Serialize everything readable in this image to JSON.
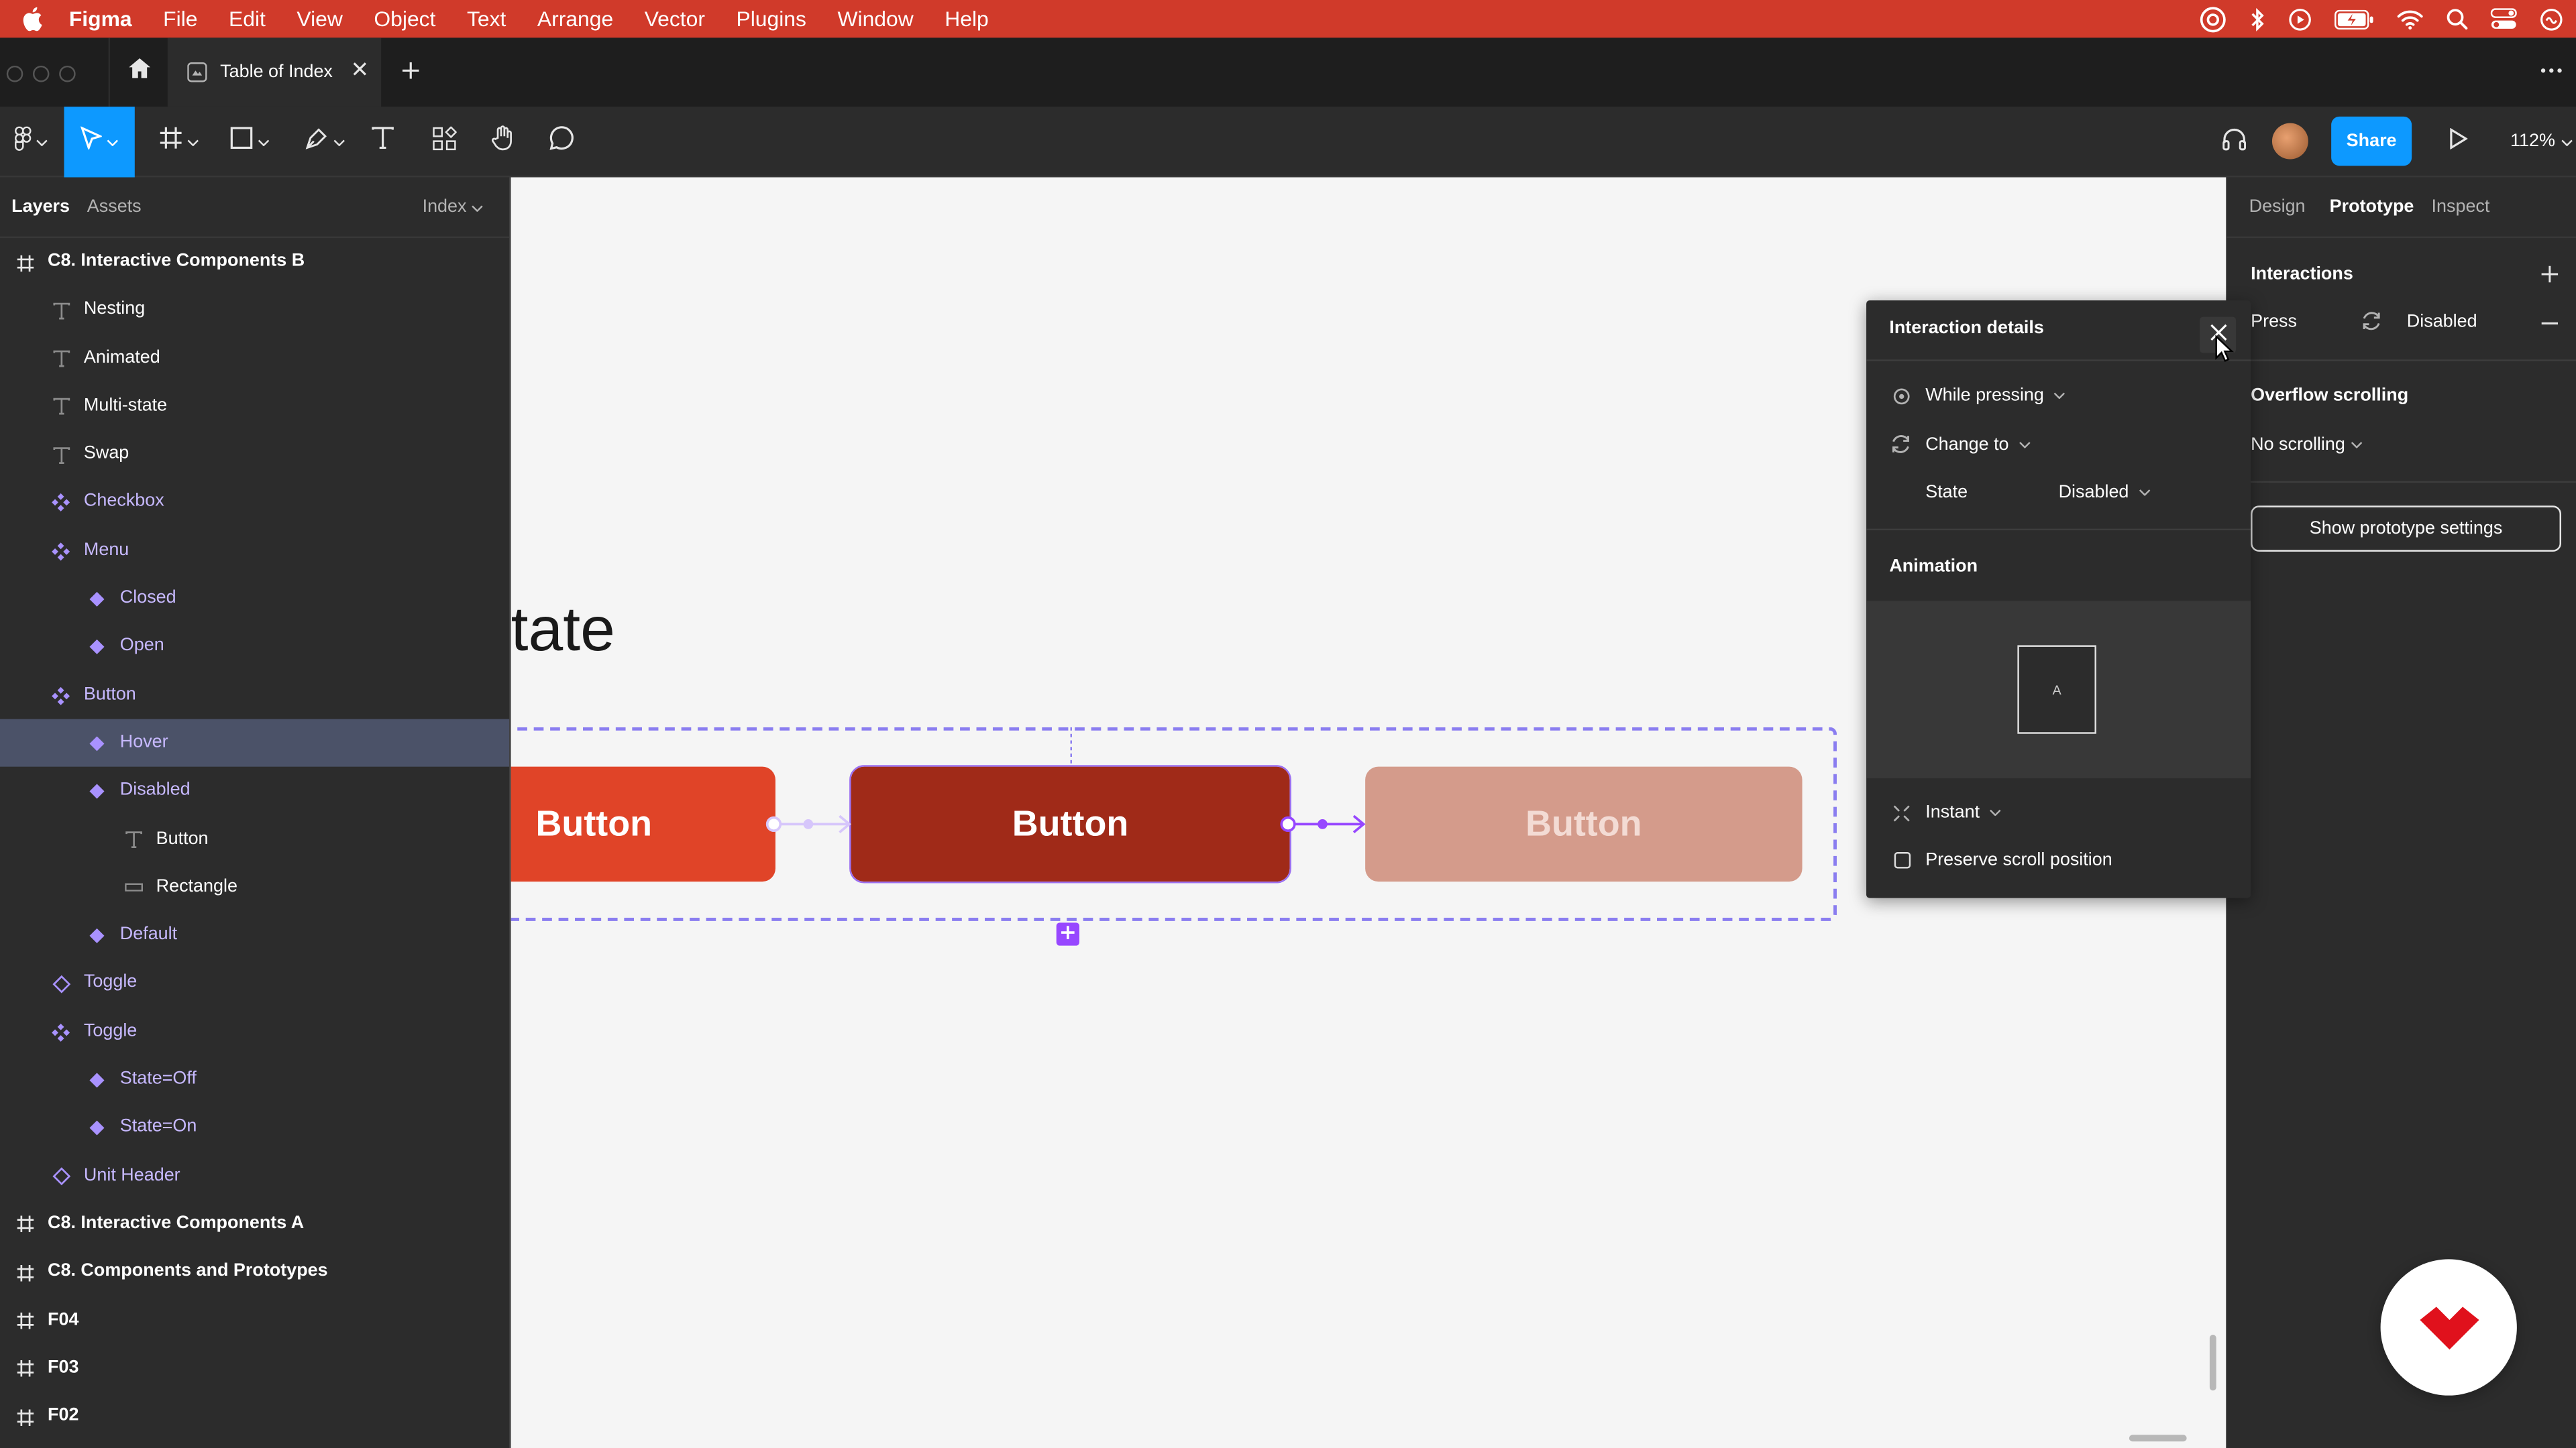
{
  "menubar": {
    "app_name": "Figma",
    "items": [
      "File",
      "Edit",
      "View",
      "Object",
      "Text",
      "Arrange",
      "Vector",
      "Plugins",
      "Window",
      "Help"
    ]
  },
  "tabbar": {
    "doc_title": "Table of Index"
  },
  "toolbar": {
    "share_label": "Share",
    "zoom": "112%"
  },
  "layers_panel": {
    "tab_layers": "Layers",
    "tab_assets": "Assets",
    "page_selector": "Index",
    "rows": [
      {
        "label": "C8. Interactive Components B",
        "kind": "frame",
        "indent": 0
      },
      {
        "label": "Nesting",
        "kind": "text",
        "indent": 1
      },
      {
        "label": "Animated",
        "kind": "text",
        "indent": 1
      },
      {
        "label": "Multi-state",
        "kind": "text",
        "indent": 1
      },
      {
        "label": "Swap",
        "kind": "text",
        "indent": 1
      },
      {
        "label": "Checkbox",
        "kind": "component-set",
        "indent": 1
      },
      {
        "label": "Menu",
        "kind": "component-set",
        "indent": 1
      },
      {
        "label": "Closed",
        "kind": "variant",
        "indent": 2
      },
      {
        "label": "Open",
        "kind": "variant",
        "indent": 2
      },
      {
        "label": "Button",
        "kind": "component-set",
        "indent": 1
      },
      {
        "label": "Hover",
        "kind": "variant",
        "indent": 2,
        "selected": true
      },
      {
        "label": "Disabled",
        "kind": "variant",
        "indent": 2
      },
      {
        "label": "Button",
        "kind": "text-plain",
        "indent": 3
      },
      {
        "label": "Rectangle",
        "kind": "rect",
        "indent": 3
      },
      {
        "label": "Default",
        "kind": "variant",
        "indent": 2
      },
      {
        "label": "Toggle",
        "kind": "instance",
        "indent": 1
      },
      {
        "label": "Toggle",
        "kind": "component-set",
        "indent": 1
      },
      {
        "label": "State=Off",
        "kind": "variant",
        "indent": 2
      },
      {
        "label": "State=On",
        "kind": "variant",
        "indent": 2
      },
      {
        "label": "Unit Header",
        "kind": "instance",
        "indent": 1
      },
      {
        "label": "C8. Interactive Components A",
        "kind": "frame",
        "indent": 0
      },
      {
        "label": "C8. Components and Prototypes",
        "kind": "frame",
        "indent": 0
      },
      {
        "label": "F04",
        "kind": "frame",
        "indent": 0
      },
      {
        "label": "F03",
        "kind": "frame",
        "indent": 0
      },
      {
        "label": "F02",
        "kind": "frame",
        "indent": 0
      }
    ]
  },
  "canvas": {
    "heading_fragment": "tate",
    "button_default_label": "Button",
    "button_hover_label": "Button",
    "button_disabled_label": "Button"
  },
  "interaction_popup": {
    "title": "Interaction details",
    "trigger": "While pressing",
    "action": "Change to",
    "state_label": "State",
    "state_value": "Disabled",
    "animation_title": "Animation",
    "preview_letter": "A",
    "animation_type": "Instant",
    "preserve_scroll_label": "Preserve scroll position",
    "preserve_scroll_checked": false
  },
  "right_panel": {
    "tabs": [
      "Design",
      "Prototype",
      "Inspect"
    ],
    "active_tab": "Prototype",
    "interactions_title": "Interactions",
    "interaction_trigger": "Press",
    "interaction_target": "Disabled",
    "overflow_title": "Overflow scrolling",
    "overflow_value": "No scrolling",
    "show_settings_label": "Show prototype settings"
  },
  "colors": {
    "menubar": "#d03a2a",
    "accent": "#0d99ff",
    "button_default": "#e04428",
    "button_hover": "#a02a18",
    "button_disabled": "#d49b8b",
    "prototype_purple": "#9747ff"
  },
  "icons": {
    "menubar_tray": [
      "creative-cloud-icon",
      "bluetooth-icon",
      "play-circle-icon",
      "battery-icon",
      "wifi-icon",
      "search-icon",
      "control-center-icon",
      "siri-icon"
    ]
  }
}
